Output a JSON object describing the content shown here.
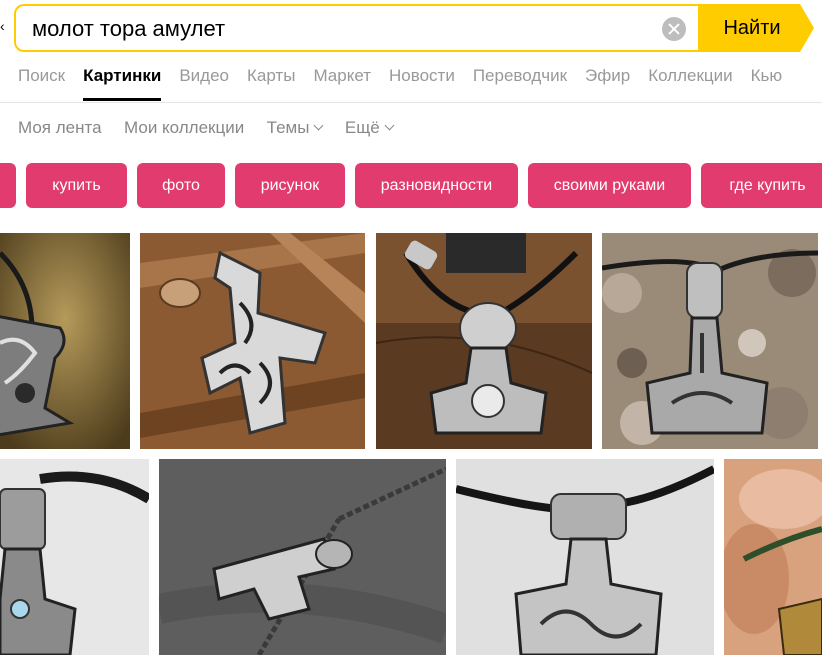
{
  "search": {
    "query": "молот тора амулет",
    "button_label": "Найти"
  },
  "services": [
    {
      "label": "Поиск",
      "active": false
    },
    {
      "label": "Картинки",
      "active": true
    },
    {
      "label": "Видео",
      "active": false
    },
    {
      "label": "Карты",
      "active": false
    },
    {
      "label": "Маркет",
      "active": false
    },
    {
      "label": "Новости",
      "active": false
    },
    {
      "label": "Переводчик",
      "active": false
    },
    {
      "label": "Эфир",
      "active": false
    },
    {
      "label": "Коллекции",
      "active": false
    },
    {
      "label": "Кью",
      "active": false
    }
  ],
  "subnav": {
    "feed": "Моя лента",
    "collections": "Мои коллекции",
    "themes": "Темы",
    "more": "Ещё"
  },
  "chips": [
    "купить",
    "фото",
    "рисунок",
    "разновидности",
    "своими руками",
    "где купить"
  ],
  "colors": {
    "accent": "#ffcc00",
    "chip": "#e23b6f",
    "active_text": "#000000",
    "inactive_text": "#999999"
  },
  "images": [
    {
      "alt": "amulet-on-gold-stone"
    },
    {
      "alt": "celtic-hammer-on-wood"
    },
    {
      "alt": "bear-hammer-on-cord"
    },
    {
      "alt": "hammer-on-pebbles"
    },
    {
      "alt": "hammer-with-gem"
    },
    {
      "alt": "hammer-on-chain"
    },
    {
      "alt": "hammer-on-braided-cord"
    },
    {
      "alt": "hammer-in-hand"
    }
  ]
}
